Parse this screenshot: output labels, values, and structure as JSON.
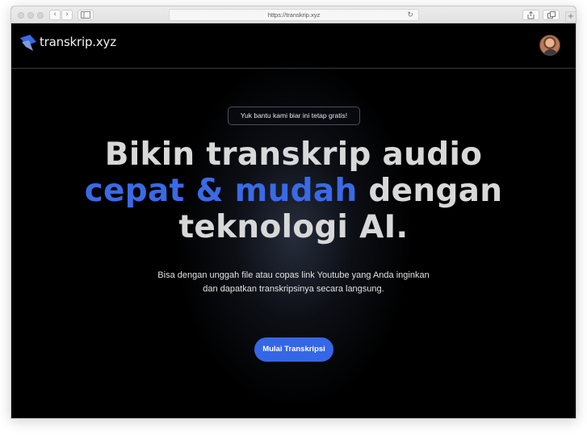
{
  "browser": {
    "url": "https://transkrip.xyz",
    "back_icon": "chevron-left-icon",
    "forward_icon": "chevron-right-icon",
    "sidebar_icon": "sidebar-icon",
    "reload_icon": "reload-icon",
    "share_icon": "share-icon",
    "tabs_icon": "tabs-icon",
    "new_tab_icon": "plus-icon"
  },
  "header": {
    "brand": "transkrip.xyz",
    "logo_icon": "transkrip-logo-icon",
    "avatar": "user-avatar"
  },
  "hero": {
    "badge": "Yuk bantu kami biar ini tetap gratis!",
    "headline_part1": "Bikin transkrip audio",
    "headline_accent": "cepat & mudah",
    "headline_part2": " dengan",
    "headline_part3": "teknologi AI.",
    "subtitle_line1": "Bisa dengan unggah file atau copas link Youtube yang Anda inginkan",
    "subtitle_line2": "dan dapatkan transkripsinya secara langsung.",
    "cta_label": "Mulai Transkripsi"
  },
  "colors": {
    "background": "#000000",
    "accent": "#3a6ae6",
    "button": "#3566e6",
    "headline": "#d8d8d8"
  }
}
